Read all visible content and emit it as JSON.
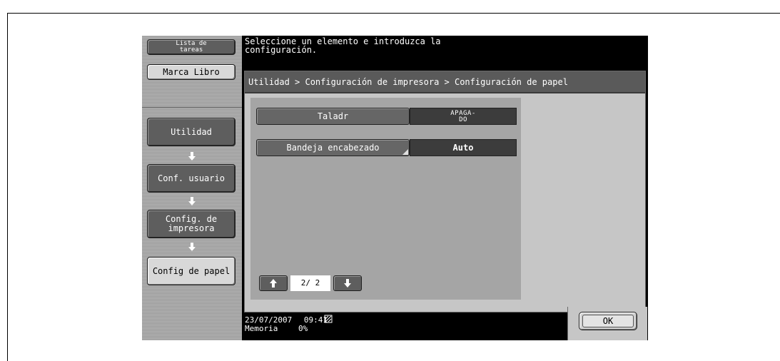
{
  "left_nav": {
    "job_list_line1": "Lista de",
    "job_list_line2": "tareas",
    "bookmark": "Marca Libro",
    "utility": "Utilidad",
    "user_settings": "Conf. usuario",
    "printer_settings_line1": "Config. de",
    "printer_settings_line2": "impresora",
    "paper_settings": "Config de papel"
  },
  "message": {
    "line1": "Seleccione un elemento e introduzca la",
    "line2": "configuración."
  },
  "breadcrumb": "Utilidad > Configuración de impresora > Configuración de papel",
  "settings": [
    {
      "label": "Taladr",
      "value_line1": "APAGA-",
      "value_line2": "DO"
    },
    {
      "label": "Bandeja encabezado",
      "value": "Auto"
    }
  ],
  "pager": {
    "page": "2/ 2"
  },
  "status": {
    "date": "23/07/2007",
    "time": "09:41",
    "memory_label": "Memoria",
    "memory_value": "0%"
  },
  "ok_button": "OK",
  "icons": [
    "down-arrow-icon",
    "up-arrow-icon",
    "memory-icon"
  ]
}
